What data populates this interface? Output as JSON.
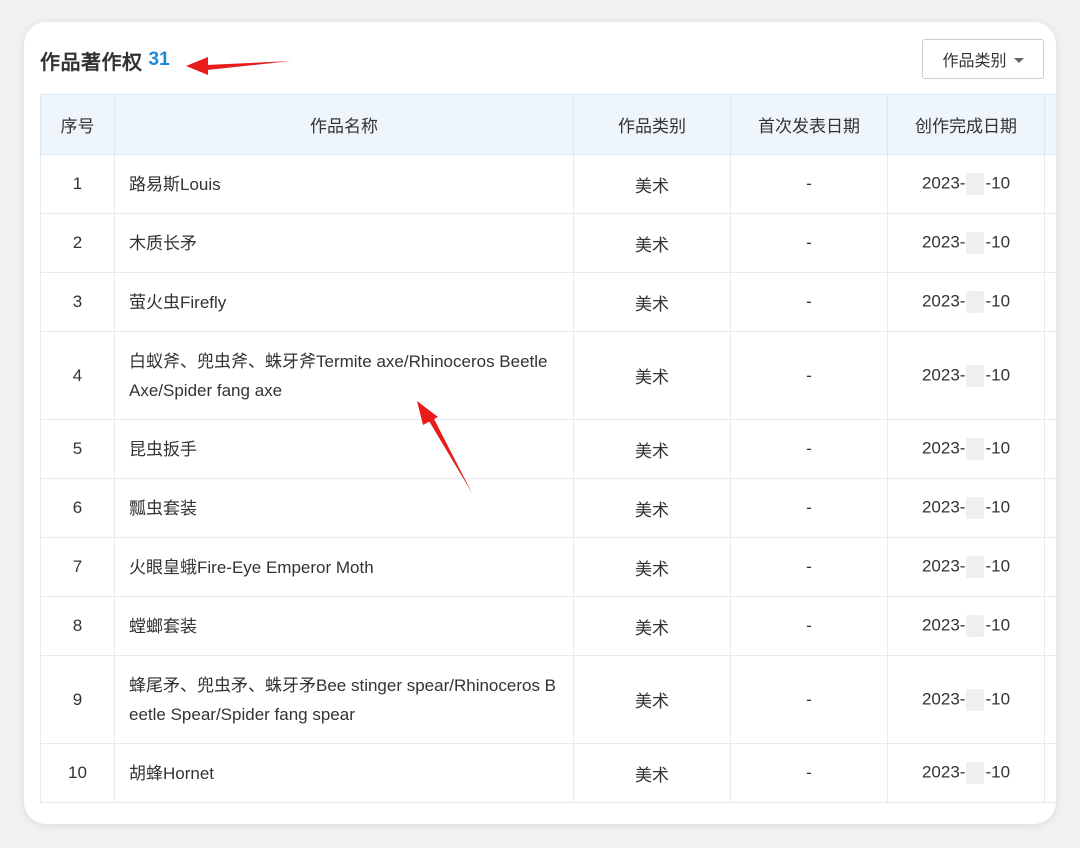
{
  "header": {
    "title": "作品著作权",
    "count": "31",
    "filter_label": "作品类别"
  },
  "table": {
    "columns": [
      "序号",
      "作品名称",
      "作品类别",
      "首次发表日期",
      "创作完成日期"
    ],
    "rows": [
      {
        "index": "1",
        "name": "路易斯Louis",
        "category": "美术",
        "first_pub": "-",
        "date_start": "2023-",
        "date_end": "-10"
      },
      {
        "index": "2",
        "name": "木质长矛",
        "category": "美术",
        "first_pub": "-",
        "date_start": "2023-",
        "date_end": "-10"
      },
      {
        "index": "3",
        "name": "萤火虫Firefly",
        "category": "美术",
        "first_pub": "-",
        "date_start": "2023-",
        "date_end": "-10"
      },
      {
        "index": "4",
        "name": "白蚁斧、兜虫斧、蛛牙斧Termite axe/Rhinoceros Beetle Axe/Spider fang axe",
        "category": "美术",
        "first_pub": "-",
        "date_start": "2023-",
        "date_end": "-10"
      },
      {
        "index": "5",
        "name": "昆虫扳手",
        "category": "美术",
        "first_pub": "-",
        "date_start": "2023-",
        "date_end": "-10"
      },
      {
        "index": "6",
        "name": "瓢虫套装",
        "category": "美术",
        "first_pub": "-",
        "date_start": "2023-",
        "date_end": "-10"
      },
      {
        "index": "7",
        "name": "火眼皇蛾Fire-Eye Emperor Moth",
        "category": "美术",
        "first_pub": "-",
        "date_start": "2023-",
        "date_end": "-10"
      },
      {
        "index": "8",
        "name": "螳螂套装",
        "category": "美术",
        "first_pub": "-",
        "date_start": "2023-",
        "date_end": "-10"
      },
      {
        "index": "9",
        "name": "蜂尾矛、兜虫矛、蛛牙矛Bee stinger spear/Rhinoceros Beetle Spear/Spider fang spear",
        "category": "美术",
        "first_pub": "-",
        "date_start": "2023-",
        "date_end": "-10"
      },
      {
        "index": "10",
        "name": "胡蜂Hornet",
        "category": "美术",
        "first_pub": "-",
        "date_start": "2023-",
        "date_end": "-10"
      }
    ]
  },
  "colors": {
    "accent": "#1e88d8",
    "header_bg": "#eef5fb",
    "annotation_arrow": "#e81c1c"
  }
}
